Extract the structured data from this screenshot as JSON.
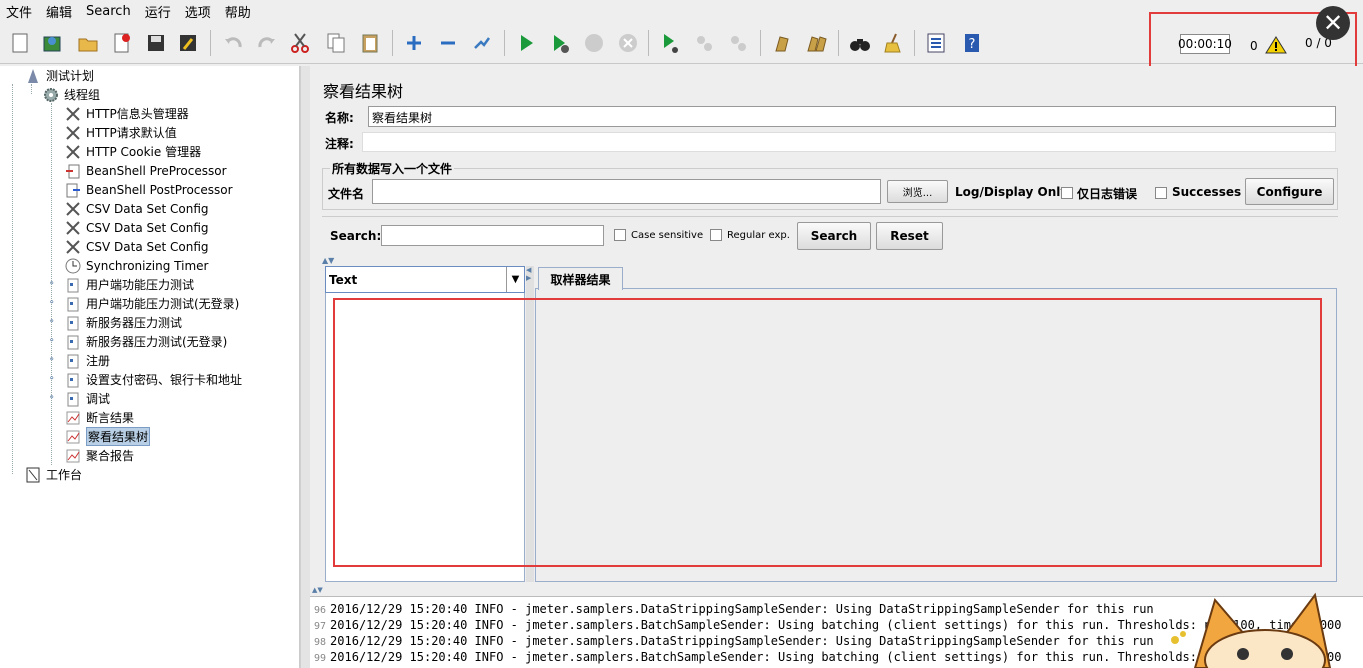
{
  "menubar": {
    "items": [
      "文件",
      "编辑",
      "Search",
      "运行",
      "选项",
      "帮助"
    ]
  },
  "toolbar": {
    "icons": [
      "new-icon",
      "templates-icon",
      "open-icon",
      "close-icon",
      "save-icon",
      "save-as-icon",
      "undo-icon",
      "redo-icon",
      "cut-icon",
      "copy-icon",
      "paste-icon",
      "expand-icon",
      "collapse-icon",
      "toggle-icon",
      "start-icon",
      "start-no-pause-icon",
      "stop-icon",
      "shutdown-icon",
      "remote-start-icon",
      "remote-stop-icon",
      "remote-shutdown-icon",
      "clear-icon",
      "clear-all-icon",
      "search-binoculars-icon",
      "reset-search-broom-icon",
      "function-helper-icon",
      "help-icon"
    ]
  },
  "status": {
    "timer": "00:00:10",
    "errors": "0",
    "threads": "0 / 0"
  },
  "tree": {
    "items": [
      {
        "label": "测试计划",
        "icon": "test-plan-icon"
      },
      {
        "label": "线程组",
        "icon": "thread-group-gear-icon"
      },
      {
        "label": "HTTP信息头管理器",
        "icon": "config-tools-icon"
      },
      {
        "label": "HTTP请求默认值",
        "icon": "config-tools-icon"
      },
      {
        "label": "HTTP Cookie 管理器",
        "icon": "config-tools-icon"
      },
      {
        "label": "BeanShell PreProcessor",
        "icon": "preprocessor-icon"
      },
      {
        "label": "BeanShell PostProcessor",
        "icon": "postprocessor-icon"
      },
      {
        "label": "CSV Data Set Config",
        "icon": "config-tools-icon"
      },
      {
        "label": "CSV Data Set Config",
        "icon": "config-tools-icon"
      },
      {
        "label": "CSV Data Set Config",
        "icon": "config-tools-icon"
      },
      {
        "label": "Synchronizing Timer",
        "icon": "timer-icon"
      },
      {
        "label": "用户端功能压力测试",
        "icon": "controller-icon"
      },
      {
        "label": "用户端功能压力测试(无登录)",
        "icon": "controller-icon"
      },
      {
        "label": "新服务器压力测试",
        "icon": "controller-icon"
      },
      {
        "label": "新服务器压力测试(无登录)",
        "icon": "controller-icon"
      },
      {
        "label": "注册",
        "icon": "controller-icon"
      },
      {
        "label": "设置支付密码、银行卡和地址",
        "icon": "controller-icon"
      },
      {
        "label": "调试",
        "icon": "controller-icon"
      },
      {
        "label": "断言结果",
        "icon": "listener-graph-icon"
      },
      {
        "label": "察看结果树",
        "icon": "listener-graph-icon"
      },
      {
        "label": "聚合报告",
        "icon": "listener-graph-icon"
      },
      {
        "label": "工作台",
        "icon": "workbench-icon"
      }
    ]
  },
  "panel": {
    "title": "察看结果树",
    "name_label": "名称:",
    "name_value": "察看结果树",
    "comment_label": "注释:",
    "file_section": "所有数据写入一个文件",
    "filename_label": "文件名",
    "browse": "浏览...",
    "log_display": "Log/Display Only:",
    "errors_only": "仅日志错误",
    "successes": "Successes",
    "configure": "Configure",
    "search_label": "Search:",
    "case_sensitive": "Case sensitive",
    "regular_exp": "Regular exp.",
    "search_btn": "Search",
    "reset_btn": "Reset",
    "renderer": "Text",
    "result_tab": "取样器结果"
  },
  "log": [
    {
      "n": "96",
      "text": "2016/12/29 15:20:40 INFO  - jmeter.samplers.DataStrippingSampleSender: Using DataStrippingSampleSender for this run"
    },
    {
      "n": "97",
      "text": "2016/12/29 15:20:40 INFO  - jmeter.samplers.BatchSampleSender: Using batching (client settings) for this run. Thresholds: num=100, time=60000"
    },
    {
      "n": "98",
      "text": "2016/12/29 15:20:40 INFO  - jmeter.samplers.DataStrippingSampleSender: Using DataStrippingSampleSender for this run"
    },
    {
      "n": "99",
      "text": "2016/12/29 15:20:40 INFO  - jmeter.samplers.BatchSampleSender: Using batching (client settings) for this run. Thresholds: num=100, time=60000"
    }
  ]
}
